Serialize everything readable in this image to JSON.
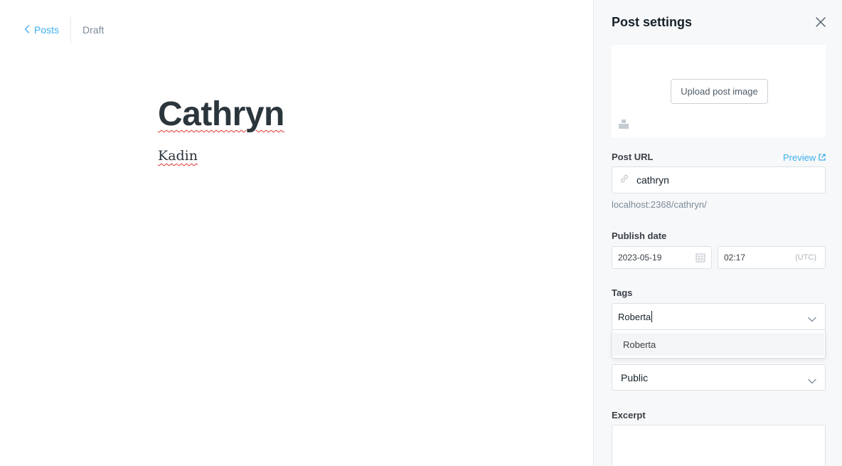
{
  "editor": {
    "back_label": "Posts",
    "status": "Draft",
    "title": "Cathryn",
    "body": "Kadin"
  },
  "settings": {
    "title": "Post settings",
    "upload_label": "Upload post image",
    "url": {
      "label": "Post URL",
      "preview_label": "Preview",
      "value": "cathryn",
      "hint": "localhost:2368/cathryn/"
    },
    "publish": {
      "label": "Publish date",
      "date": "2023-05-19",
      "time": "02:17",
      "timezone": "(UTC)"
    },
    "tags": {
      "label": "Tags",
      "value": "Roberta",
      "options": [
        "Roberta"
      ]
    },
    "visibility": {
      "value": "Public"
    },
    "excerpt": {
      "label": "Excerpt",
      "value": ""
    }
  },
  "colors": {
    "accent": "#3eb0ef",
    "text": "#15212a",
    "muted": "#7c8b9a",
    "panel_bg": "#f7f8f9"
  },
  "icons": [
    "chevron-left-icon",
    "close-icon",
    "image-icon",
    "link-icon",
    "external-link-icon",
    "calendar-icon",
    "chevron-down-icon"
  ]
}
